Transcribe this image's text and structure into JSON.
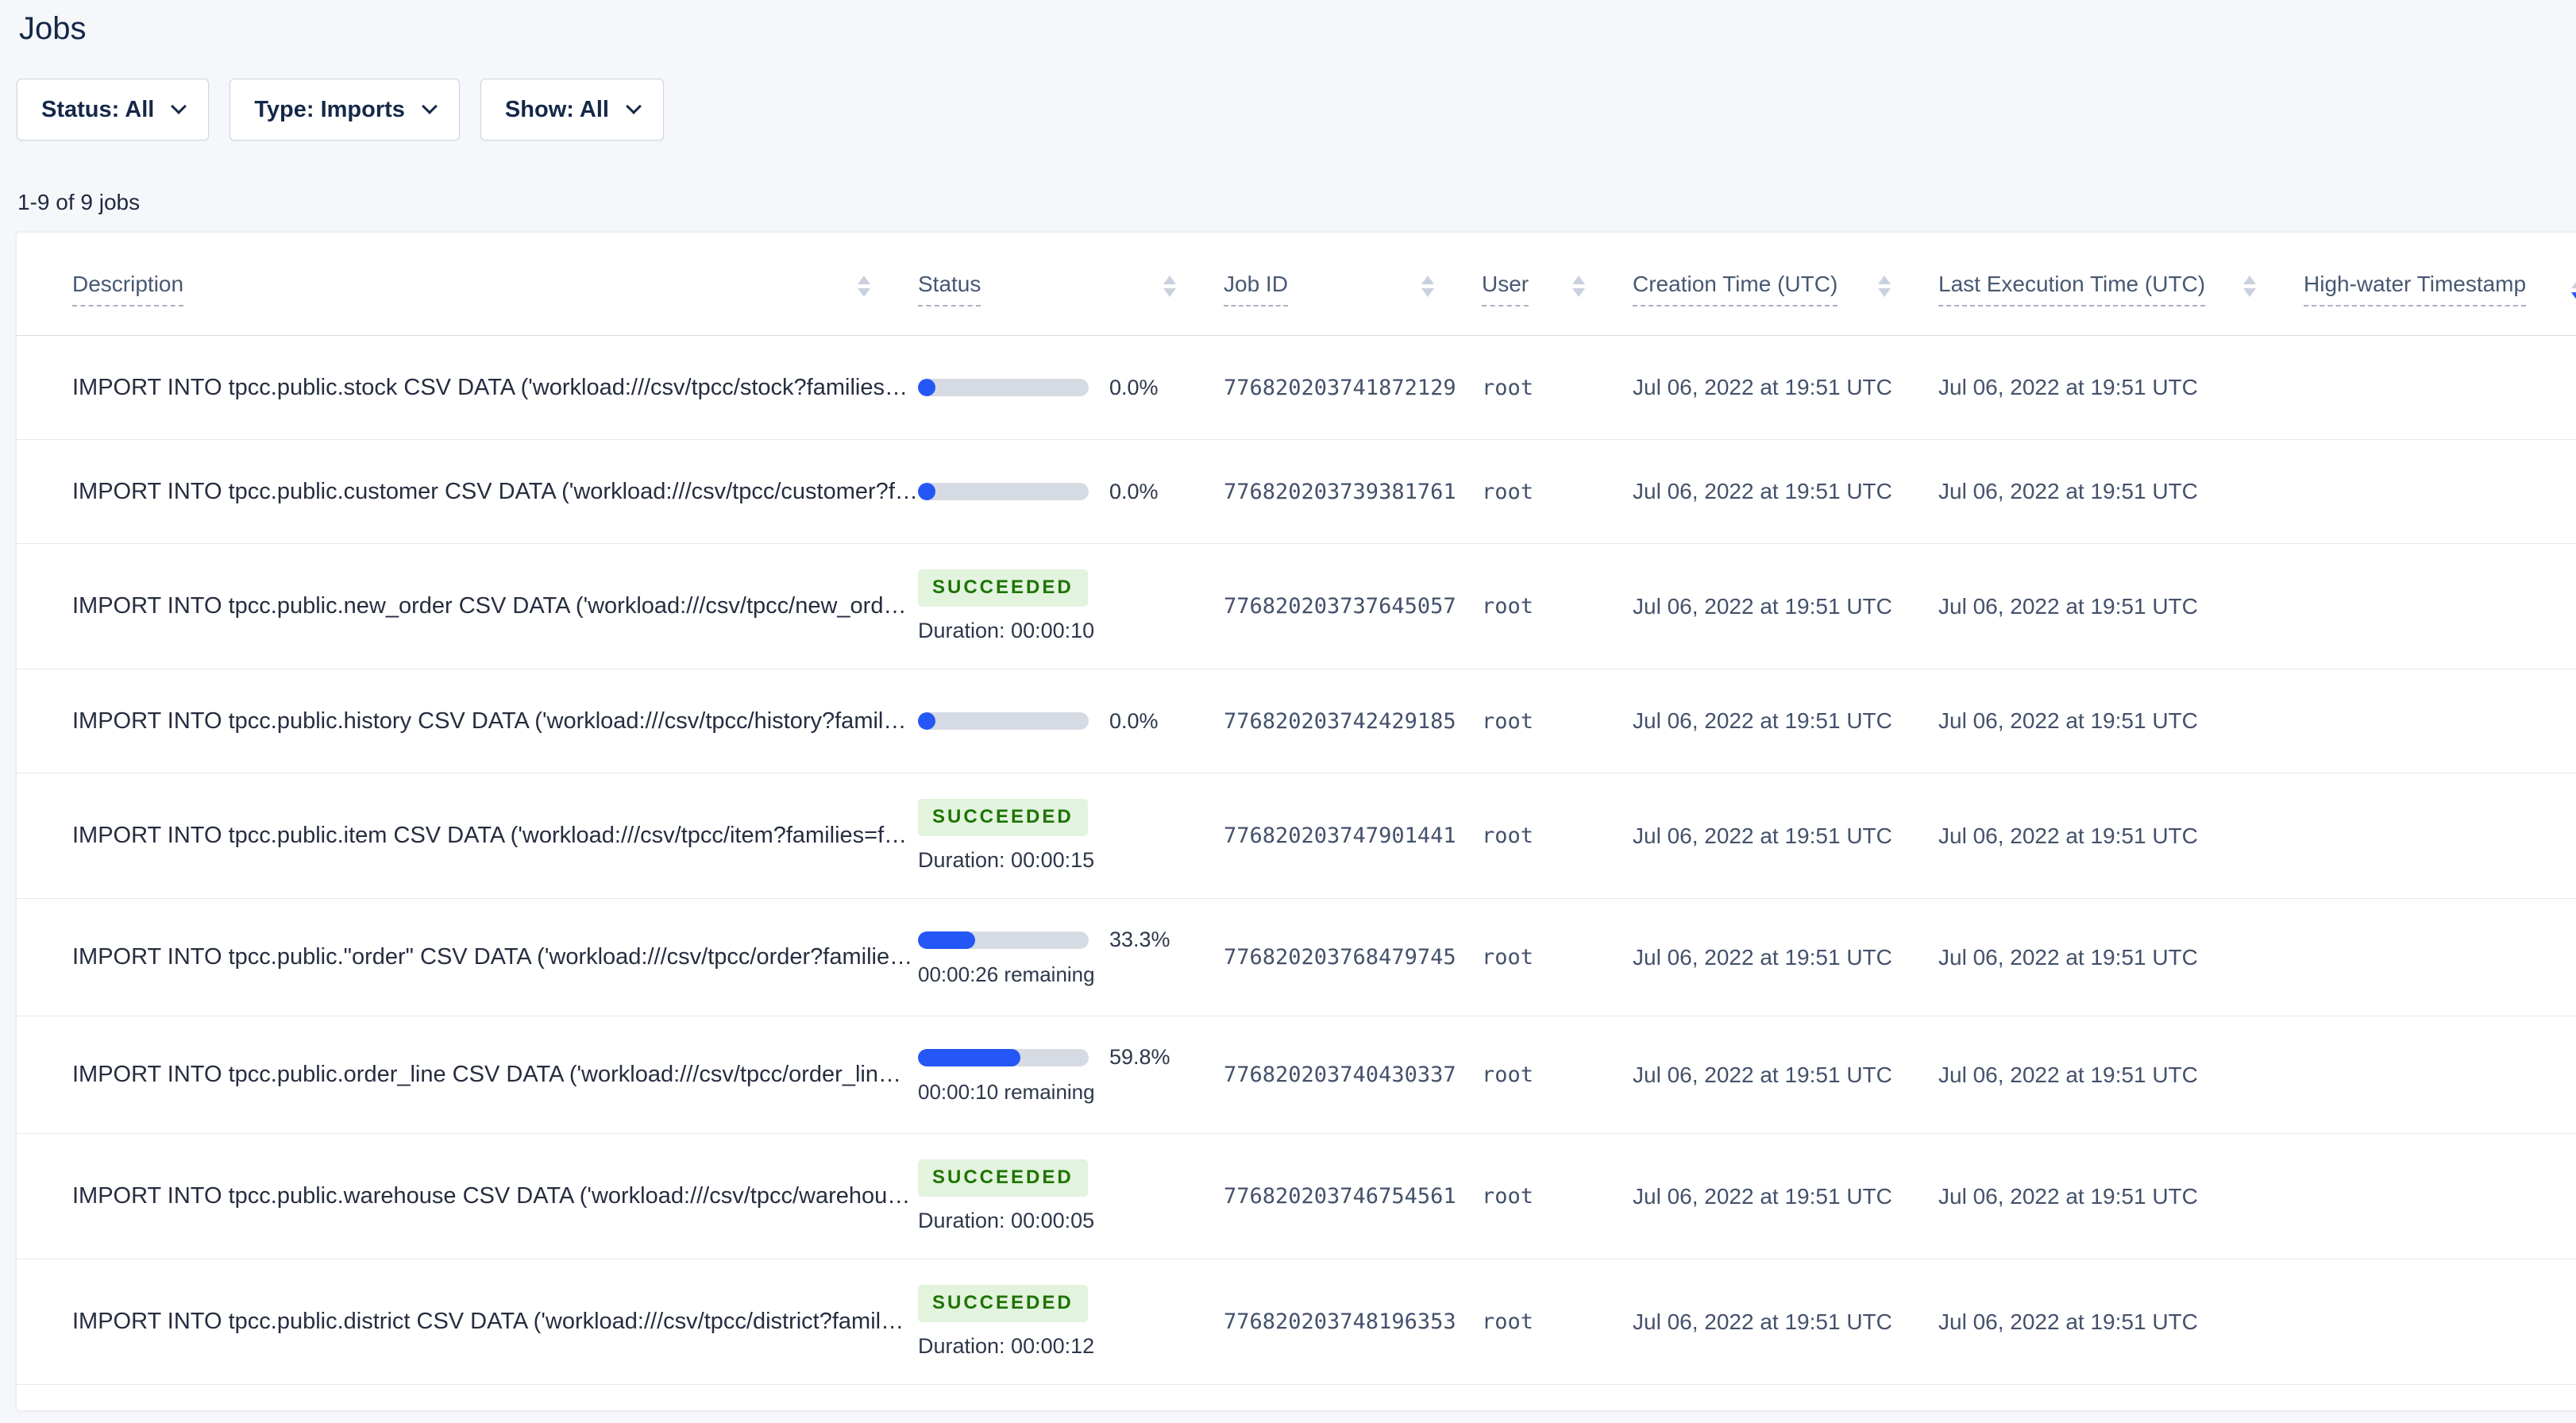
{
  "page": {
    "title": "Jobs",
    "results_count": "1-9 of 9 jobs"
  },
  "filters": {
    "status": "Status: All",
    "type": "Type: Imports",
    "show": "Show: All"
  },
  "table": {
    "columns": [
      "Description",
      "Status",
      "Job ID",
      "User",
      "Creation Time (UTC)",
      "Last Execution Time (UTC)",
      "High-water Timestamp"
    ],
    "rows": [
      {
        "description": "IMPORT INTO tpcc.public.stock CSV DATA ('workload:///csv/tpcc/stock?families…",
        "status": {
          "kind": "progress",
          "percent_label": "0.0%",
          "fraction": 0.0,
          "remaining": ""
        },
        "job_id": "776820203741872129",
        "user": "root",
        "creation_time": "Jul 06, 2022 at 19:51 UTC",
        "last_execution_time": "Jul 06, 2022 at 19:51 UTC",
        "high_water_timestamp": ""
      },
      {
        "description": "IMPORT INTO tpcc.public.customer CSV DATA ('workload:///csv/tpcc/customer?f…",
        "status": {
          "kind": "progress",
          "percent_label": "0.0%",
          "fraction": 0.0,
          "remaining": ""
        },
        "job_id": "776820203739381761",
        "user": "root",
        "creation_time": "Jul 06, 2022 at 19:51 UTC",
        "last_execution_time": "Jul 06, 2022 at 19:51 UTC",
        "high_water_timestamp": ""
      },
      {
        "description": "IMPORT INTO tpcc.public.new_order CSV DATA ('workload:///csv/tpcc/new_ord…",
        "status": {
          "kind": "succeeded",
          "badge": "SUCCEEDED",
          "duration": "Duration: 00:00:10"
        },
        "job_id": "776820203737645057",
        "user": "root",
        "creation_time": "Jul 06, 2022 at 19:51 UTC",
        "last_execution_time": "Jul 06, 2022 at 19:51 UTC",
        "high_water_timestamp": ""
      },
      {
        "description": "IMPORT INTO tpcc.public.history CSV DATA ('workload:///csv/tpcc/history?famil…",
        "status": {
          "kind": "progress",
          "percent_label": "0.0%",
          "fraction": 0.0,
          "remaining": ""
        },
        "job_id": "776820203742429185",
        "user": "root",
        "creation_time": "Jul 06, 2022 at 19:51 UTC",
        "last_execution_time": "Jul 06, 2022 at 19:51 UTC",
        "high_water_timestamp": ""
      },
      {
        "description": "IMPORT INTO tpcc.public.item CSV DATA ('workload:///csv/tpcc/item?families=f…",
        "status": {
          "kind": "succeeded",
          "badge": "SUCCEEDED",
          "duration": "Duration: 00:00:15"
        },
        "job_id": "776820203747901441",
        "user": "root",
        "creation_time": "Jul 06, 2022 at 19:51 UTC",
        "last_execution_time": "Jul 06, 2022 at 19:51 UTC",
        "high_water_timestamp": ""
      },
      {
        "description": "IMPORT INTO tpcc.public.\"order\" CSV DATA ('workload:///csv/tpcc/order?familie…",
        "status": {
          "kind": "progress",
          "percent_label": "33.3%",
          "fraction": 0.333,
          "remaining": "00:00:26 remaining"
        },
        "job_id": "776820203768479745",
        "user": "root",
        "creation_time": "Jul 06, 2022 at 19:51 UTC",
        "last_execution_time": "Jul 06, 2022 at 19:51 UTC",
        "high_water_timestamp": ""
      },
      {
        "description": "IMPORT INTO tpcc.public.order_line CSV DATA ('workload:///csv/tpcc/order_lin…",
        "status": {
          "kind": "progress",
          "percent_label": "59.8%",
          "fraction": 0.598,
          "remaining": "00:00:10 remaining"
        },
        "job_id": "776820203740430337",
        "user": "root",
        "creation_time": "Jul 06, 2022 at 19:51 UTC",
        "last_execution_time": "Jul 06, 2022 at 19:51 UTC",
        "high_water_timestamp": ""
      },
      {
        "description": "IMPORT INTO tpcc.public.warehouse CSV DATA ('workload:///csv/tpcc/warehou…",
        "status": {
          "kind": "succeeded",
          "badge": "SUCCEEDED",
          "duration": "Duration: 00:00:05"
        },
        "job_id": "776820203746754561",
        "user": "root",
        "creation_time": "Jul 06, 2022 at 19:51 UTC",
        "last_execution_time": "Jul 06, 2022 at 19:51 UTC",
        "high_water_timestamp": ""
      },
      {
        "description": "IMPORT INTO tpcc.public.district CSV DATA ('workload:///csv/tpcc/district?famil…",
        "status": {
          "kind": "succeeded",
          "badge": "SUCCEEDED",
          "duration": "Duration: 00:00:12"
        },
        "job_id": "776820203748196353",
        "user": "root",
        "creation_time": "Jul 06, 2022 at 19:51 UTC",
        "last_execution_time": "Jul 06, 2022 at 19:51 UTC",
        "high_water_timestamp": ""
      }
    ]
  },
  "colors": {
    "accent_blue": "#2457f5",
    "progress_track": "#d6dae3",
    "success_badge_bg": "#e2f3de",
    "success_badge_text": "#1e7400",
    "page_background": "#f5f7fa",
    "title_text": "#152849"
  }
}
